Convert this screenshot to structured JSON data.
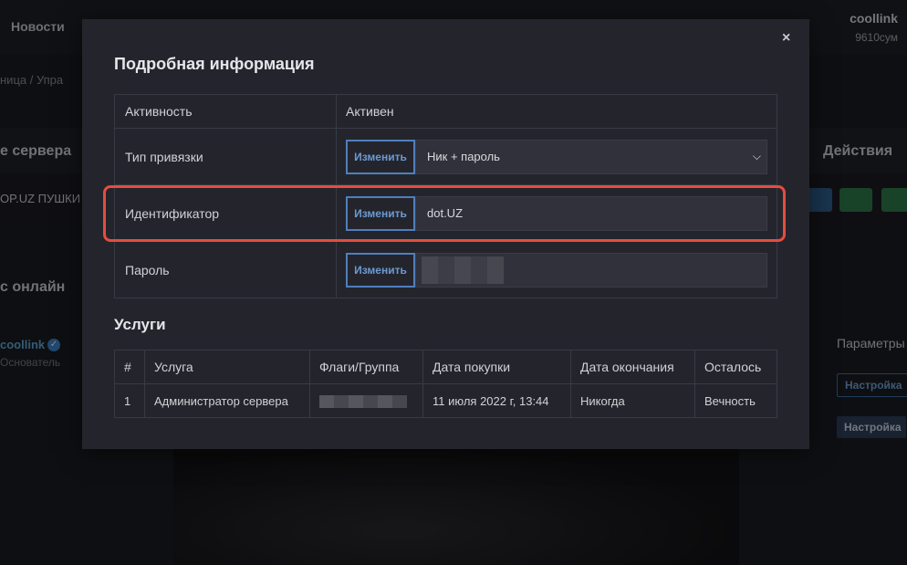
{
  "background": {
    "nav_label": "Новости",
    "user_name": "coollink",
    "balance": "9610сум",
    "breadcrumb": "ница   /   Упра",
    "table_head_left": "е сервера",
    "table_head_right": "Действия",
    "server_name": "OP.UZ ПУШКИ",
    "online_title": "с онлайн",
    "online_user": "coollink",
    "online_user_role": "Основатель",
    "params_label": "Параметры",
    "settings_label": "Настройка"
  },
  "modal": {
    "close_glyph": "×",
    "title": "Подробная информация",
    "change_label": "Изменить",
    "rows": {
      "activity": {
        "label": "Активность",
        "value": "Активен"
      },
      "binding": {
        "label": "Тип привязки",
        "value": "Ник + пароль"
      },
      "identifier": {
        "label": "Идентификатор",
        "value": "dot.UZ"
      },
      "password": {
        "label": "Пароль"
      }
    },
    "services_title": "Услуги",
    "services_headers": [
      "#",
      "Услуга",
      "Флаги/Группа",
      "Дата покупки",
      "Дата окончания",
      "Осталось"
    ],
    "services_rows": [
      {
        "num": "1",
        "service": "Администратор сервера",
        "purchase": "11 июля 2022 г, 13:44",
        "end": "Никогда",
        "left": "Вечность"
      }
    ]
  },
  "colors": {
    "accent": "#4f7fbd",
    "success": "#3fba6f",
    "highlight": "#e54c3f"
  }
}
